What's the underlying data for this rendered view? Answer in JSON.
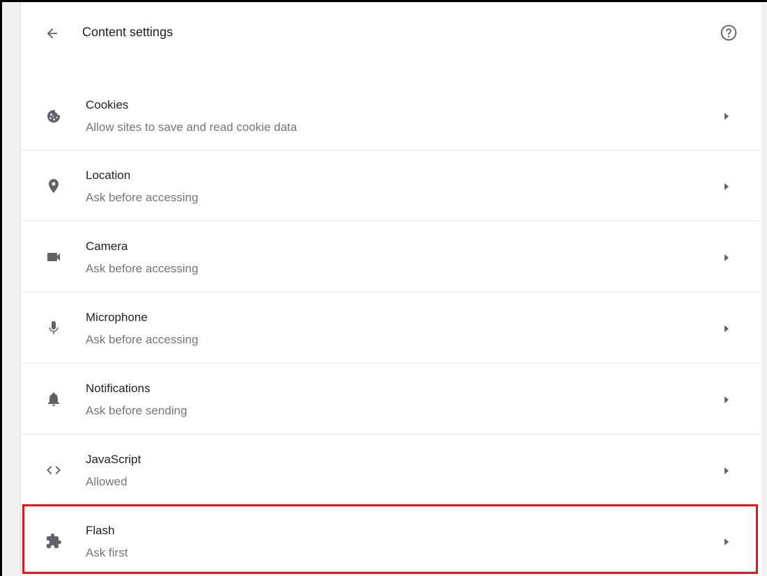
{
  "header": {
    "title": "Content settings",
    "back_icon": "arrow-back-icon",
    "help_icon": "help-circle-icon"
  },
  "colors": {
    "icon": "#5f6368",
    "subtext": "#757575",
    "highlight": "#e8141c",
    "divider": "#e6e6e6"
  },
  "settings": [
    {
      "label": "Cookies",
      "status": "Allow sites to save and read cookie data",
      "icon": "cookie-icon"
    },
    {
      "label": "Location",
      "status": "Ask before accessing",
      "icon": "location-pin-icon"
    },
    {
      "label": "Camera",
      "status": "Ask before accessing",
      "icon": "camera-icon"
    },
    {
      "label": "Microphone",
      "status": "Ask before accessing",
      "icon": "microphone-icon"
    },
    {
      "label": "Notifications",
      "status": "Ask before sending",
      "icon": "bell-icon"
    },
    {
      "label": "JavaScript",
      "status": "Allowed",
      "icon": "code-icon"
    },
    {
      "label": "Flash",
      "status": "Ask first",
      "icon": "puzzle-piece-icon"
    }
  ]
}
